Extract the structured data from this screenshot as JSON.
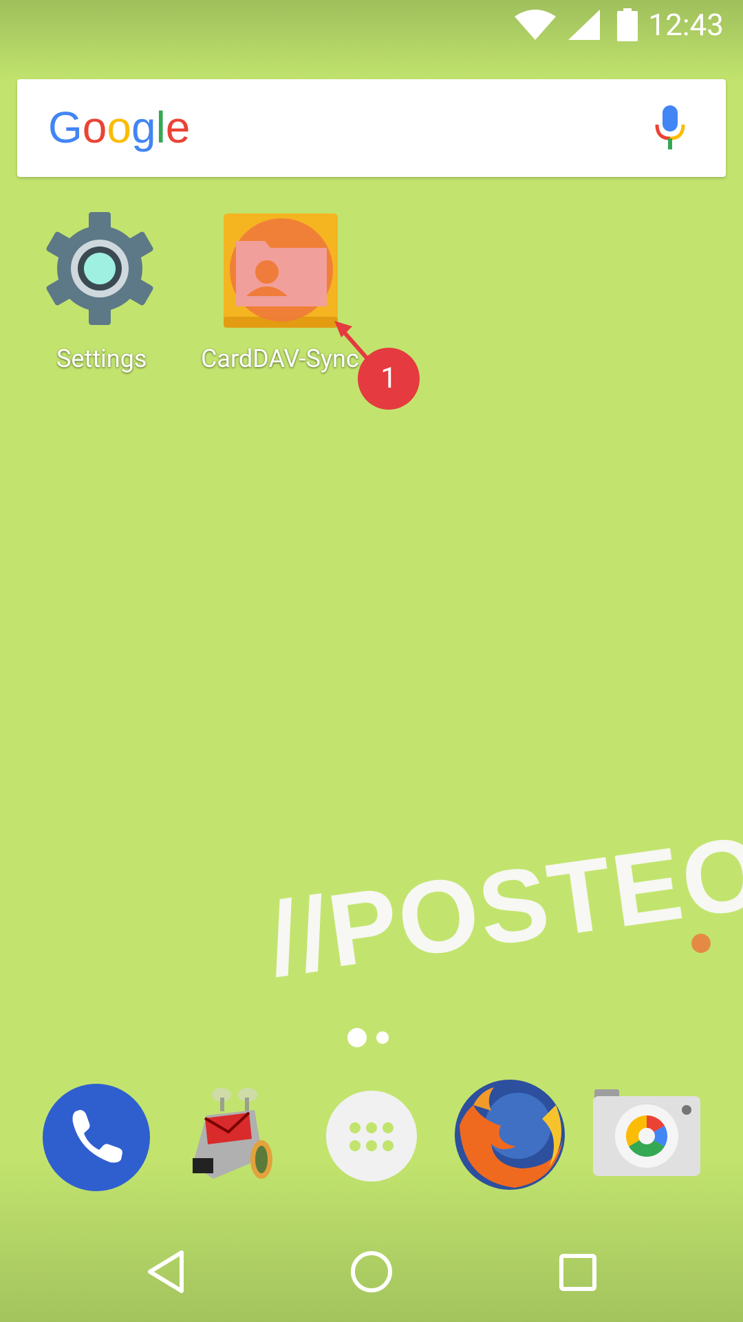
{
  "status_bar": {
    "time": "12:43",
    "icons": [
      "wifi-icon",
      "signal-icon",
      "battery-icon"
    ]
  },
  "search_widget": {
    "logo_text": "Google",
    "mic_icon": "mic-icon"
  },
  "home_apps": [
    {
      "label": "Settings",
      "icon": "settings-gear-icon"
    },
    {
      "label": "CardDAV-Sync...",
      "icon": "carddav-contacts-folder-icon"
    }
  ],
  "annotation": {
    "number": "1"
  },
  "wallpaper": {
    "text": "//POSTEO",
    "accent_color": "#e58a45"
  },
  "page_indicator": {
    "pages": 2,
    "current": 1
  },
  "dock": [
    {
      "name": "phone-icon"
    },
    {
      "name": "mail-robot-icon"
    },
    {
      "name": "app-drawer-icon"
    },
    {
      "name": "firefox-icon"
    },
    {
      "name": "camera-icon"
    }
  ],
  "nav_bar": [
    "back-icon",
    "home-icon",
    "recents-icon"
  ],
  "colors": {
    "background": "#c2e46e",
    "badge": "#e53a3f",
    "phone_blue": "#2f5fcf"
  }
}
